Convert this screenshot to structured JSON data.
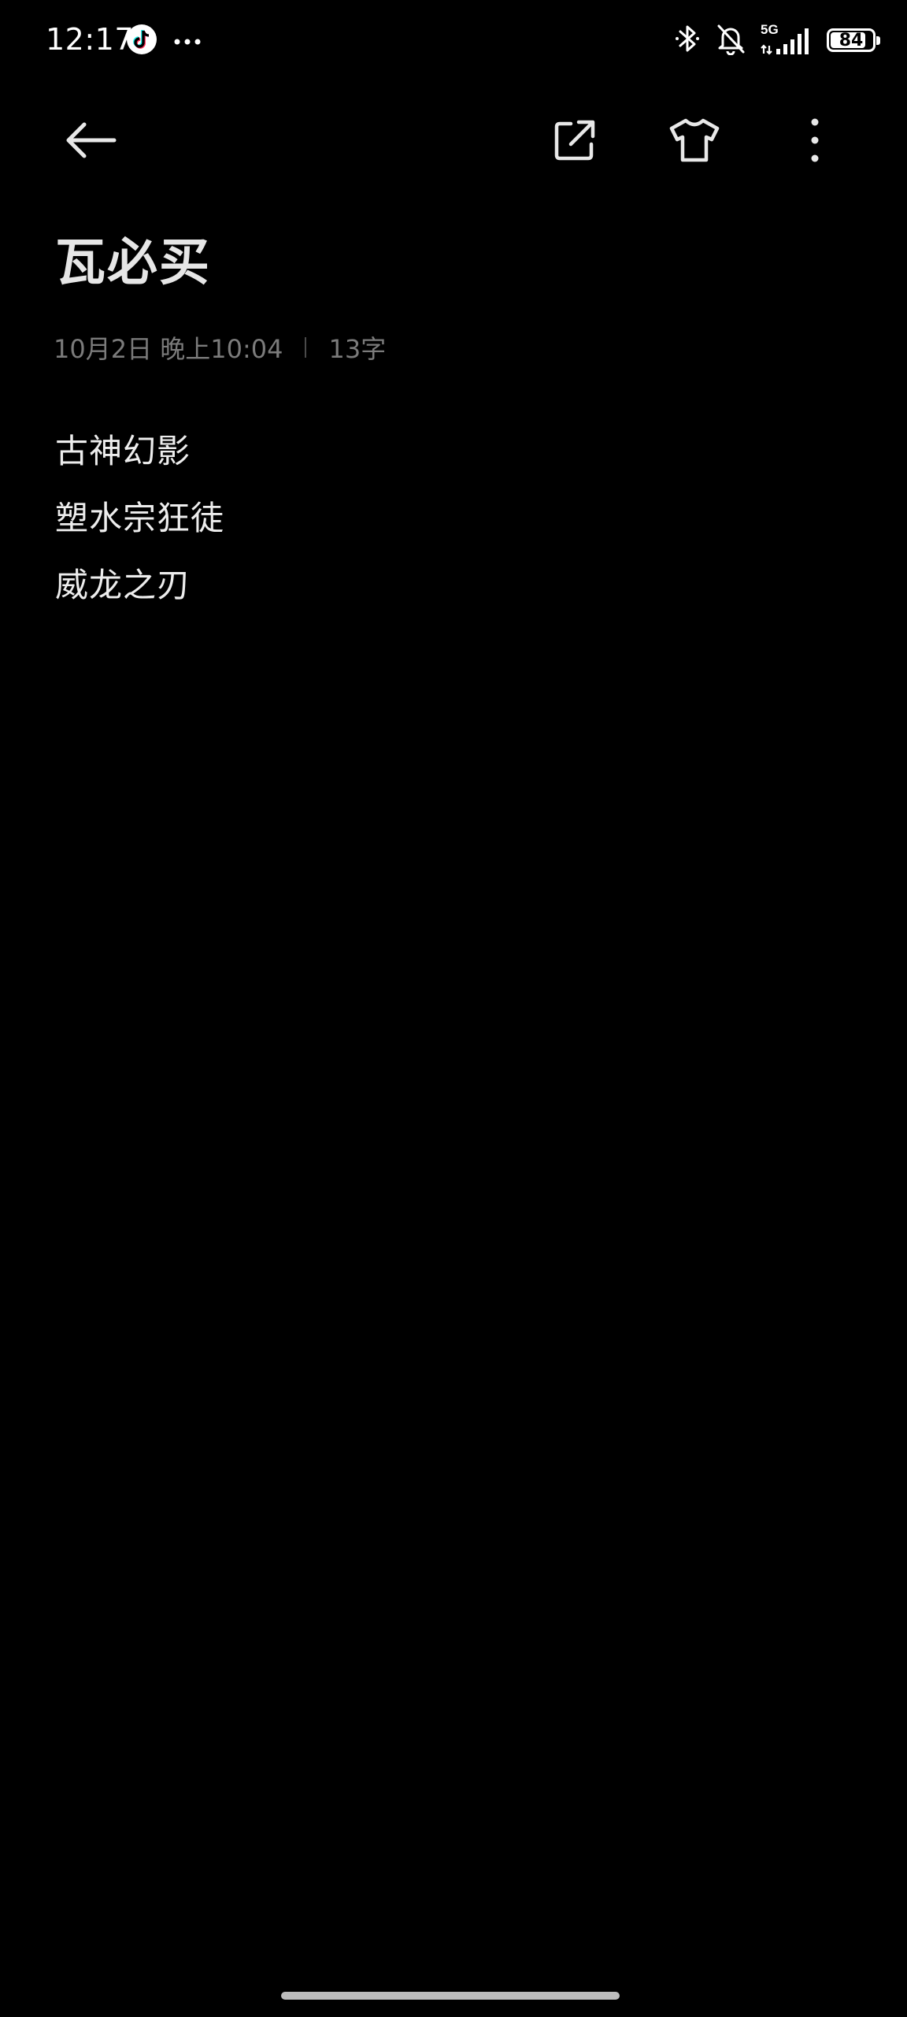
{
  "status_bar": {
    "time": "12:17",
    "left_icons": [
      "tiktok-icon",
      "more-dots-icon"
    ],
    "right_icons": [
      "bluetooth-icon",
      "bell-off-icon",
      "signal-5g-icon",
      "battery-icon"
    ],
    "network": "5G",
    "battery_level": "84",
    "battery_fraction": 0.84
  },
  "toolbar": {
    "back_icon": "arrow-left-icon",
    "share_icon": "share-external-icon",
    "theme_icon": "tshirt-icon",
    "more_icon": "more-vertical-icon"
  },
  "note": {
    "title": "瓦必买",
    "date": "10月2日 晚上10:04",
    "word_count": "13字",
    "lines": [
      "古神幻影",
      "塑水宗狂徒",
      "威龙之刃"
    ]
  },
  "colors": {
    "background": "#000000",
    "title": "#e6e6e6",
    "meta": "#7b7b7b",
    "body_text": "#ededed"
  }
}
